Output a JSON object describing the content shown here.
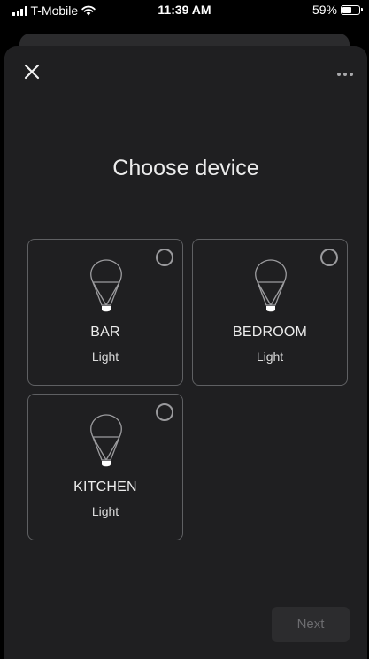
{
  "status_bar": {
    "carrier": "T-Mobile",
    "time": "11:39 AM",
    "battery_percent": "59%",
    "battery_level": 0.59,
    "icons": [
      "signal-icon",
      "wifi-icon",
      "battery-icon"
    ]
  },
  "header": {
    "close_icon": "close-icon",
    "more_icon": "more-options-icon"
  },
  "title": "Choose device",
  "devices": [
    {
      "name": "BAR",
      "type": "Light",
      "selected": false,
      "icon": "light-bulb-icon"
    },
    {
      "name": "BEDROOM",
      "type": "Light",
      "selected": false,
      "icon": "light-bulb-icon"
    },
    {
      "name": "KITCHEN",
      "type": "Light",
      "selected": false,
      "icon": "light-bulb-icon"
    }
  ],
  "footer": {
    "next_label": "Next",
    "next_enabled": false
  },
  "colors": {
    "background": "#000000",
    "sheet": "#1f1f21",
    "card_border": "#5f6063",
    "text": "#ececec",
    "disabled_button": "#2c2c2e",
    "disabled_text": "#6c6c6f"
  }
}
